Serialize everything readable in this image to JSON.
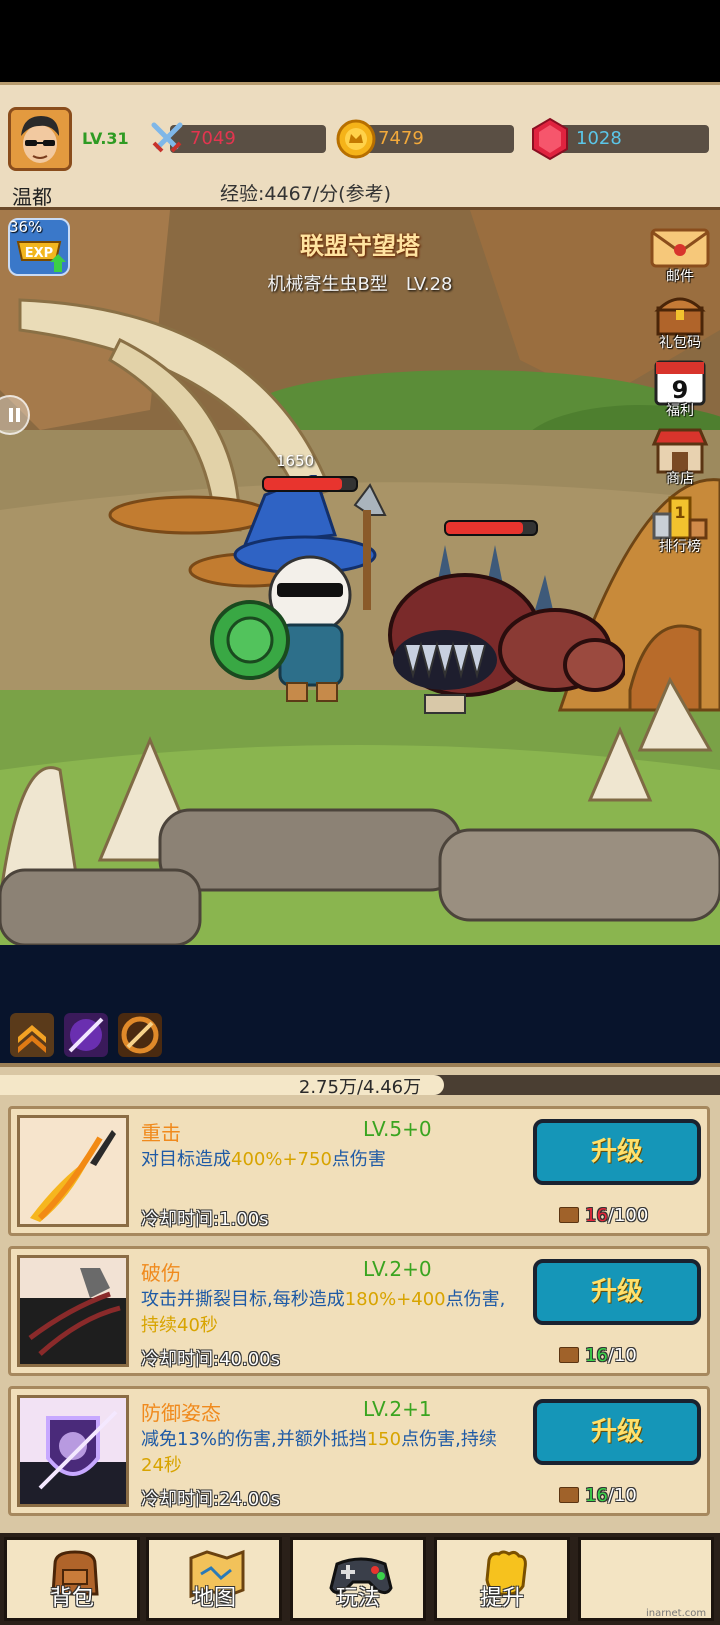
{
  "player": {
    "level": "LV.31",
    "name": "温都",
    "attack": "7049",
    "gold": "7479",
    "gems": "1028",
    "exp_rate": "经验:4467/分(参考)"
  },
  "stage": {
    "title": "联盟守望塔",
    "enemy_name": "机械寄生虫B型",
    "enemy_level": "LV.28",
    "damage_number": "1650",
    "exp_percent": "36%",
    "player_hp_fraction": 0.85,
    "enemy_hp_fraction": 0.85
  },
  "side_menu": [
    {
      "label": "邮件",
      "icon": "mail-icon"
    },
    {
      "label": "礼包码",
      "icon": "treasure-chest-icon"
    },
    {
      "label": "福利",
      "icon": "calendar-icon",
      "badge": "9"
    },
    {
      "label": "商店",
      "icon": "shop-icon"
    },
    {
      "label": "排行榜",
      "icon": "leaderboard-icon",
      "badge": "1"
    }
  ],
  "progress": {
    "text": "2.75万/4.46万",
    "fraction": 0.617
  },
  "skills": [
    {
      "name": "重击",
      "level": "LV.5+0",
      "desc_a": "对目标造成",
      "desc_hl": "400%+750",
      "desc_b": "点伤害",
      "desc_c": "",
      "cooldown": "冷却时间:1.00s",
      "cost_have": "16",
      "cost_need": "/100",
      "button": "升级"
    },
    {
      "name": "破伤",
      "level": "LV.2+0",
      "desc_a": "攻击并撕裂目标,每秒造成",
      "desc_hl": "180%+400",
      "desc_b": "点伤害,",
      "desc_c": "持续40秒",
      "cooldown": "冷却时间:40.00s",
      "cost_have": "16",
      "cost_need": "/10",
      "button": "升级"
    },
    {
      "name": "防御姿态",
      "level": "LV.2+1",
      "desc_a": "减免13%的伤害,并额外抵挡",
      "desc_hl": "150",
      "desc_b": "点伤害,持续",
      "desc_c": "24秒",
      "cooldown": "冷却时间:24.00s",
      "cost_have": "16",
      "cost_need": "/10",
      "button": "升级"
    }
  ],
  "nav": [
    {
      "label": "背包",
      "icon": "backpack-icon"
    },
    {
      "label": "地图",
      "icon": "map-icon"
    },
    {
      "label": "玩法",
      "icon": "gamepad-icon"
    },
    {
      "label": "提升",
      "icon": "fist-icon"
    },
    {
      "label": "",
      "icon": ""
    }
  ],
  "watermark": "inarnet.com",
  "colors": {
    "header_bg": "#ecdcbf",
    "attack_text": "#e2354f",
    "gold_text": "#f2a93b",
    "gem_text": "#5bc6e8",
    "button_bg": "#1596b8",
    "button_text": "#ffe06a"
  }
}
